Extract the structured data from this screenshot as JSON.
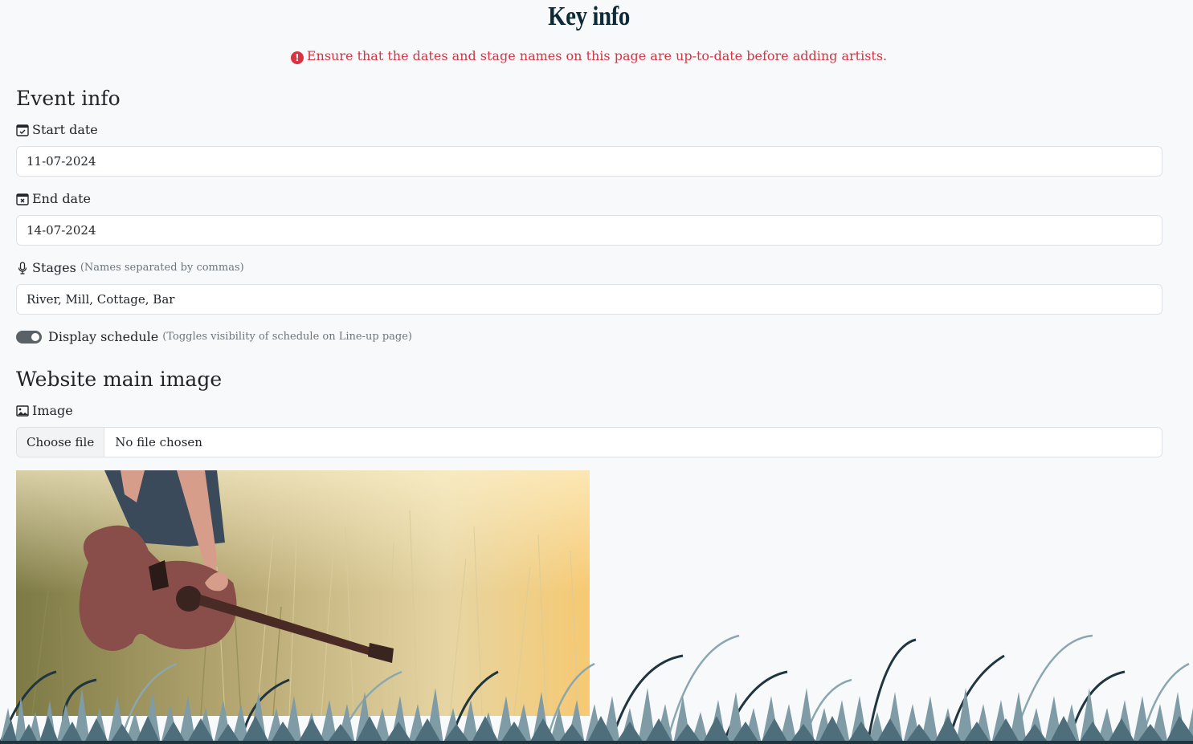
{
  "page": {
    "title": "Key info"
  },
  "warning": {
    "text": "Ensure that the dates and stage names on this page are up-to-date before adding artists.",
    "icon": "exclamation-circle-icon",
    "color": "#d63343"
  },
  "event_info": {
    "heading": "Event info",
    "start_date": {
      "label": "Start date",
      "value": "11-07-2024",
      "icon": "calendar-check-icon"
    },
    "end_date": {
      "label": "End date",
      "value": "14-07-2024",
      "icon": "calendar-x-icon"
    },
    "stages": {
      "label": "Stages",
      "hint": "(Names separated by commas)",
      "value": "River, Mill, Cottage, Bar",
      "icon": "microphone-icon"
    },
    "display_schedule": {
      "label": "Display schedule",
      "hint": "(Toggles visibility of schedule on Line-up page)",
      "checked": true
    }
  },
  "main_image": {
    "heading": "Website main image",
    "label": "Image",
    "icon": "image-icon",
    "choose_button": "Choose file",
    "file_status": "No file chosen"
  }
}
